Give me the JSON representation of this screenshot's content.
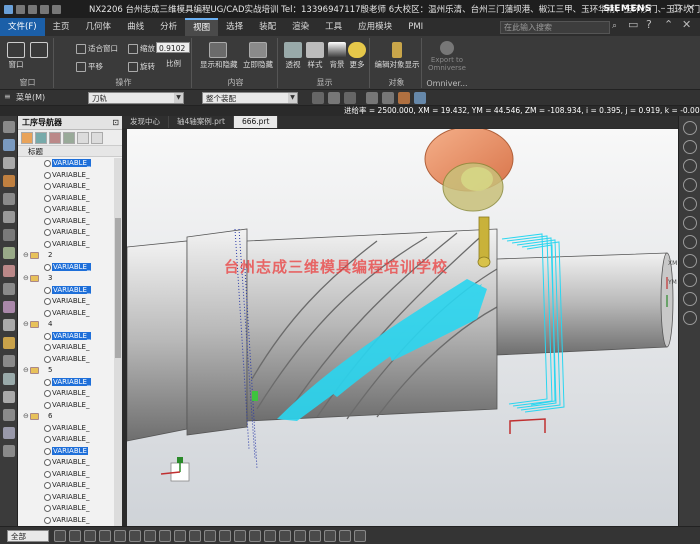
{
  "window": {
    "title": "NX2206 台州志成三维模具编程UG/CAD实战培训  Tel：13396947117殷老师 6大校区：温州乐清、台州三门蒲坝港、椒江三甲、玉环华南、玉环沙门、玉环坎门 - 加工",
    "brand": "SIEMENS",
    "controls": [
      "–",
      "▢",
      "✕"
    ]
  },
  "menu": {
    "tabs": [
      "文件(F)",
      "主页",
      "几何体",
      "曲线",
      "分析",
      "视图",
      "选择",
      "装配",
      "渲染",
      "工具",
      "应用模块",
      "PMI"
    ],
    "active_tab": "视图",
    "search_placeholder": "在此输入搜索"
  },
  "ribbon": {
    "window_group": {
      "label": "窗口",
      "new_window": "窗口"
    },
    "operation_group": {
      "label": "操作",
      "fit_window": "适合窗口",
      "pan": "平移",
      "zoom": "缩放",
      "rotate": "旋转",
      "scale_value": "0.9102",
      "scale_label": "比例"
    },
    "content_group": {
      "label": "内容",
      "show_hide": "显示和隐藏",
      "instant_hide": "立即隐藏"
    },
    "display_group": {
      "label": "显示",
      "perspective": "透视",
      "style": "样式",
      "background": "背景",
      "more": "更多"
    },
    "object_group": {
      "label": "对象",
      "edit_display": "编辑对象显示"
    },
    "omniverse_group": {
      "label": "Omniver...",
      "export": "Export to Omniverse"
    }
  },
  "toolbar2": {
    "menu_label": "菜单(M)",
    "tool_filter": "刀轨",
    "assembly_scope": "整个装配"
  },
  "status": {
    "coords": "进给率 = 2500.000, XM = 19.432, YM = 44.546, ZM = -108.934, i = 0.395, j = 0.919, k = -0.000"
  },
  "nav": {
    "title": "工序导航器",
    "column": "标题",
    "rows": [
      {
        "type": "op",
        "label": "VARIABLE_",
        "sel": true
      },
      {
        "type": "op",
        "label": "VARIABLE_",
        "sel": false
      },
      {
        "type": "op",
        "label": "VARIABLE_",
        "sel": false
      },
      {
        "type": "op",
        "label": "VARIABLE_",
        "sel": false
      },
      {
        "type": "op",
        "label": "VARIABLE_",
        "sel": false
      },
      {
        "type": "op",
        "label": "VARIABLE_",
        "sel": false
      },
      {
        "type": "op",
        "label": "VARIABLE_",
        "sel": false
      },
      {
        "type": "op",
        "label": "VARIABLE_",
        "sel": false
      },
      {
        "type": "grp",
        "label": "2",
        "sel": false
      },
      {
        "type": "op",
        "label": "VARIABLE_",
        "sel": true
      },
      {
        "type": "grp",
        "label": "3",
        "sel": false
      },
      {
        "type": "op",
        "label": "VARIABLE_",
        "sel": true
      },
      {
        "type": "op",
        "label": "VARIABLE_",
        "sel": false
      },
      {
        "type": "op",
        "label": "VARIABLE_",
        "sel": false
      },
      {
        "type": "grp",
        "label": "4",
        "sel": false
      },
      {
        "type": "op",
        "label": "VARIABLE_",
        "sel": true
      },
      {
        "type": "op",
        "label": "VARIABLE_",
        "sel": false
      },
      {
        "type": "op",
        "label": "VARIABLE_",
        "sel": false
      },
      {
        "type": "grp",
        "label": "5",
        "sel": false
      },
      {
        "type": "op",
        "label": "VARIABLE_",
        "sel": true
      },
      {
        "type": "op",
        "label": "VARIABLE_",
        "sel": false
      },
      {
        "type": "op",
        "label": "VARIABLE_",
        "sel": false
      },
      {
        "type": "grp",
        "label": "6",
        "sel": false
      },
      {
        "type": "op",
        "label": "VARIABLE_",
        "sel": false
      },
      {
        "type": "op",
        "label": "VARIABLE_",
        "sel": false
      },
      {
        "type": "op",
        "label": "VARIABLE",
        "sel": true
      },
      {
        "type": "op",
        "label": "VARIABLE_",
        "sel": false
      },
      {
        "type": "op",
        "label": "VARIABLE_",
        "sel": false
      },
      {
        "type": "op",
        "label": "VARIABLE_",
        "sel": false
      },
      {
        "type": "op",
        "label": "VARIABLE_",
        "sel": false
      },
      {
        "type": "op",
        "label": "VARIABLE_",
        "sel": false
      },
      {
        "type": "op",
        "label": "VARIABLE_",
        "sel": false
      }
    ]
  },
  "doc_tabs": [
    "发现中心",
    "轴4轴案例.prt",
    "666.prt"
  ],
  "active_doc": "666.prt",
  "viewport": {
    "watermark": "台州志成三维模具编程培训学校",
    "axis_labels": [
      "XM",
      "YM"
    ]
  },
  "bottom": {
    "selection_filter": "全部"
  },
  "colors": {
    "accent": "#1e6fd9",
    "toolpath": "#2ad6f0",
    "tool_holder": "#f08a5d",
    "tool_tip": "#c9b23a"
  }
}
